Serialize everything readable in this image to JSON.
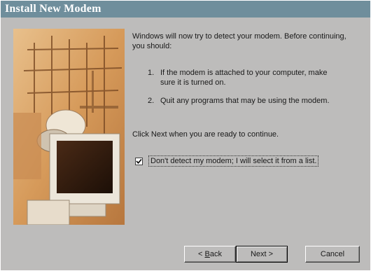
{
  "window": {
    "title": "Install New Modem"
  },
  "wizard": {
    "intro": "Windows will now try to detect your modem.  Before continuing, you should:",
    "steps": [
      {
        "num": "1.",
        "text": "If the modem is attached to your computer, make sure it is turned on."
      },
      {
        "num": "2.",
        "text": "Quit any programs that may be using the modem."
      }
    ],
    "next_note": "Click Next when you are ready to continue.",
    "checkbox": {
      "label": "Don't detect my modem; I will select it from a list.",
      "checked": true
    }
  },
  "buttons": {
    "back_prefix": "< ",
    "back_accel": "B",
    "back_rest": "ack",
    "next": "Next >",
    "cancel": "Cancel"
  },
  "colors": {
    "titlebar": "#6f8e9c",
    "dialog": "#bdbcbb",
    "art_accent": "#d6a36a"
  }
}
